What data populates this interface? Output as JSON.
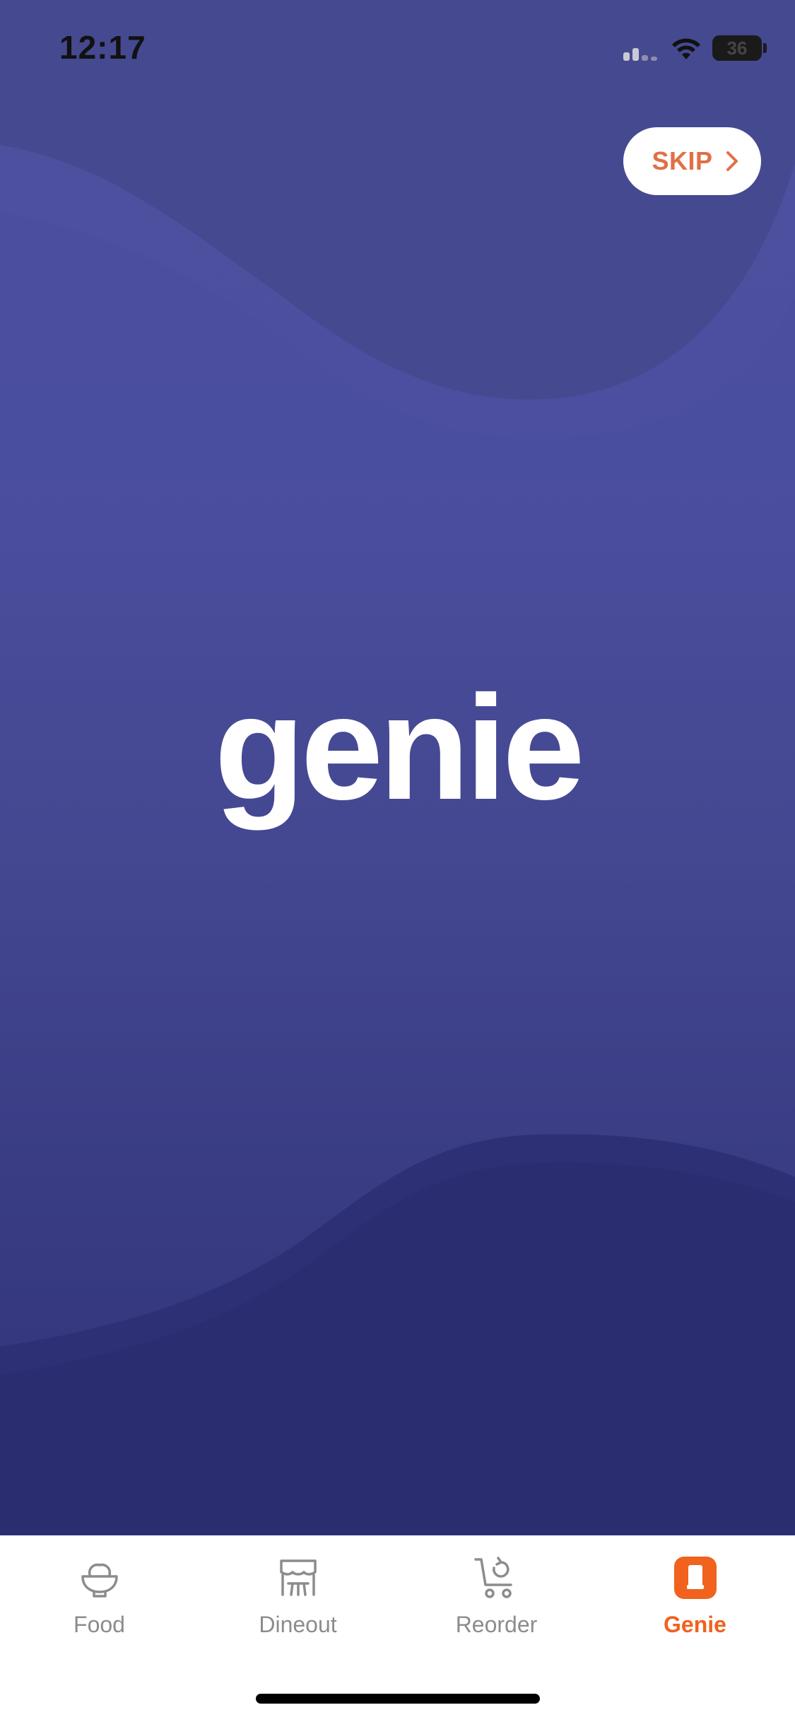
{
  "status_bar": {
    "time": "12:17",
    "battery_level": "36"
  },
  "header": {
    "skip_label": "SKIP"
  },
  "main": {
    "logo_text": "genie",
    "theme_color": "#4a4e9e",
    "accent_color": "#f0621e"
  },
  "tab_bar": {
    "items": [
      {
        "label": "Food",
        "icon": "food-bowl-icon",
        "active": false
      },
      {
        "label": "Dineout",
        "icon": "restaurant-storefront-icon",
        "active": false
      },
      {
        "label": "Reorder",
        "icon": "cart-reorder-icon",
        "active": false
      },
      {
        "label": "Genie",
        "icon": "genie-icon",
        "active": true
      }
    ]
  }
}
